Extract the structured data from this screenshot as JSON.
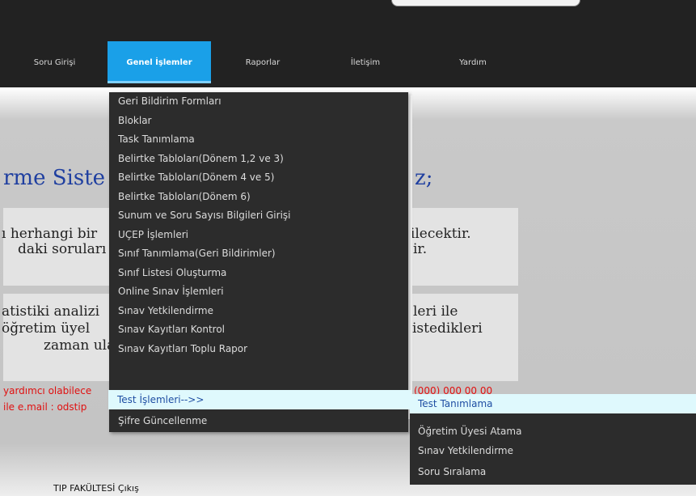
{
  "nav": {
    "items": [
      "Soru Girişi",
      "Genel İşlemler",
      "Raporlar",
      "İletişim",
      "Yardım"
    ],
    "active": "Genel İşlemler"
  },
  "page": {
    "welcome_fragment_1": "rme Siste",
    "welcome_fragment_2": "z;",
    "para1_line1_left": "ı herhangi bir",
    "para1_line1_right": "bilecektir.",
    "para1_line2_left": "daki soruları",
    "para1_line2_right": "ir.",
    "para2_line1_left": "atistiki analizi",
    "para2_line1_right": "leri ile",
    "para2_line2_left": "öğretim üyel",
    "para2_line2_right": "istedikleri",
    "para2_line3_left": "zaman ula",
    "contact_line1_left": "yardımcı olabilece",
    "contact_line1_right": "(000) 000 00 00",
    "contact_line2_left": "ile e.mail : odstip",
    "footer": "TIP FAKÜLTESİ Çıkış"
  },
  "dropdown": {
    "items": [
      "Geri Bildirim Formları",
      "Bloklar",
      "Task Tanımlama",
      "Belirtke Tabloları(Dönem 1,2 ve 3)",
      "Belirtke Tabloları(Dönem 4 ve 5)",
      "Belirtke Tabloları(Dönem 6)",
      "Sunum ve Soru Sayısı Bilgileri Girişi",
      "UÇEP İşlemleri",
      "Sınıf Tanımlama(Geri Bildirimler)",
      "Sınıf Listesi Oluşturma",
      "Online Sınav İşlemleri",
      "Sınav Yetkilendirme",
      "Sınav Kayıtları Kontrol",
      "Sınav Kayıtları Toplu Rapor",
      "Test İşlemleri-->>",
      "Şifre Güncellenme"
    ],
    "highlighted": "Test İşlemleri-->>"
  },
  "submenu": {
    "items": [
      "Test Tanımlama",
      "Öğretim Üyesi Atama",
      "Sınav Yetkilendirme",
      "Soru Sıralama"
    ],
    "highlighted": "Test Tanımlama"
  },
  "colors": {
    "header_bg": "#222222",
    "nav_active_bg": "#1aa0e8",
    "menu_bg": "#2c2c2c",
    "highlight_bg": "#dff9fd",
    "highlight_text": "#1f4ea3",
    "welcome_text": "#1f3fa0",
    "contact_text": "#e01010"
  }
}
